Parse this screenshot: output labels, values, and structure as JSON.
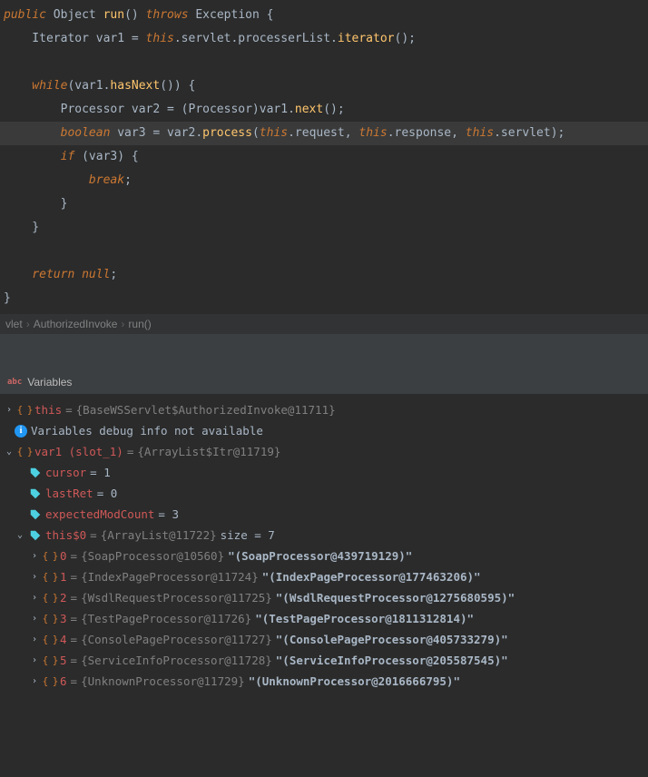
{
  "code": {
    "l1_public": "public",
    "l1_object": " Object ",
    "l1_run": "run",
    "l1_params": "() ",
    "l1_throws": "throws",
    "l1_exception": " Exception {",
    "l2": "    Iterator var1 = ",
    "l2_this": "this",
    "l2_rest": ".servlet.processerList.",
    "l2_iter": "iterator",
    "l2_end": "();",
    "l3": "",
    "l4_while": "    while",
    "l4_cond": "(var1.",
    "l4_hasnext": "hasNext",
    "l4_end": "()) {",
    "l5": "        Processor var2 = (Processor)var1.",
    "l5_next": "next",
    "l5_end": "();",
    "l6_bool": "        boolean",
    "l6_mid": " var3 = var2.",
    "l6_process": "process",
    "l6_open": "(",
    "l6_this1": "this",
    "l6_req": ".request, ",
    "l6_this2": "this",
    "l6_resp": ".response, ",
    "l6_this3": "this",
    "l6_serv": ".servlet);",
    "l7_if": "        if ",
    "l7_cond": "(var3) {",
    "l8_break": "            break",
    "l8_semi": ";",
    "l9": "        }",
    "l10": "    }",
    "l11": "",
    "l12_ret": "    return null",
    "l12_semi": ";",
    "l13": "}"
  },
  "breadcrumb": {
    "p1": "vlet",
    "p2": "AuthorizedInvoke",
    "p3": "run()"
  },
  "vars_title": "Variables",
  "vars": {
    "this_name": "this",
    "this_eq": " = ",
    "this_type": "{BaseWSServlet$AuthorizedInvoke@11711}",
    "info_text": "Variables debug info not available",
    "var1_name": "var1 (slot_1)",
    "var1_eq": " = ",
    "var1_type": "{ArrayList$Itr@11719}",
    "cursor_name": "cursor",
    "cursor_val": " = 1",
    "lastret_name": "lastRet",
    "lastret_val": " = 0",
    "expected_name": "expectedModCount",
    "expected_val": " = 3",
    "this0_name": "this$0",
    "this0_eq": " = ",
    "this0_type": "{ArrayList@11722}",
    "this0_size": "  size = 7",
    "items": [
      {
        "idx": "0",
        "type": "{SoapProcessor@10560}",
        "val": "\"(SoapProcessor@439719129)\""
      },
      {
        "idx": "1",
        "type": "{IndexPageProcessor@11724}",
        "val": "\"(IndexPageProcessor@177463206)\""
      },
      {
        "idx": "2",
        "type": "{WsdlRequestProcessor@11725}",
        "val": "\"(WsdlRequestProcessor@1275680595)\""
      },
      {
        "idx": "3",
        "type": "{TestPageProcessor@11726}",
        "val": "\"(TestPageProcessor@1811312814)\""
      },
      {
        "idx": "4",
        "type": "{ConsolePageProcessor@11727}",
        "val": "\"(ConsolePageProcessor@405733279)\""
      },
      {
        "idx": "5",
        "type": "{ServiceInfoProcessor@11728}",
        "val": "\"(ServiceInfoProcessor@205587545)\""
      },
      {
        "idx": "6",
        "type": "{UnknownProcessor@11729}",
        "val": "\"(UnknownProcessor@2016666795)\""
      }
    ]
  }
}
